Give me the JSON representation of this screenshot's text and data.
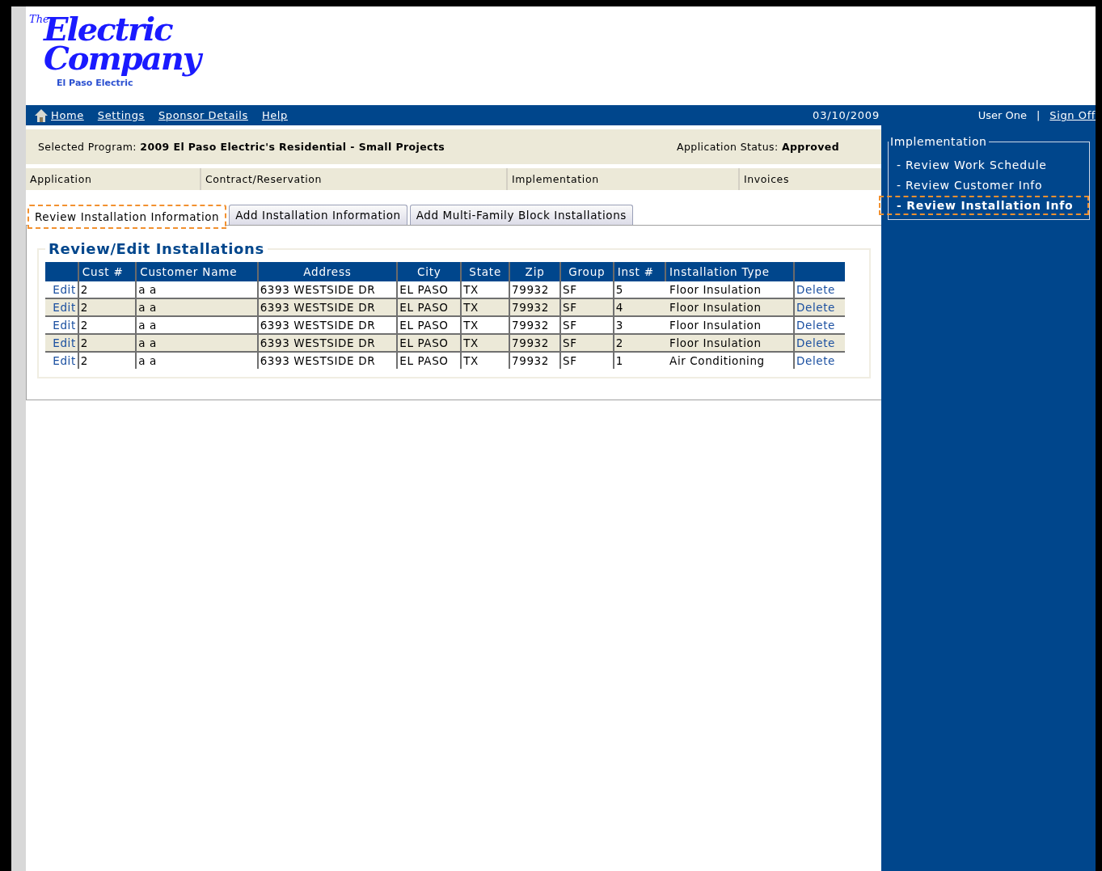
{
  "logo": {
    "small": "The",
    "line1": "Electric",
    "line2": "Company",
    "tagline": "El Paso Electric"
  },
  "nav": {
    "links": [
      "Home",
      "Settings",
      "Sponsor Details",
      "Help"
    ],
    "date": "03/10/2009",
    "user": "User One",
    "separator": "|",
    "sign_off": "Sign Off"
  },
  "program_bar": {
    "program_label": "Selected Program:",
    "program": "2009 El Paso Electric's Residential - Small Projects",
    "status_label": "Application Status:",
    "status": "Approved"
  },
  "phases": [
    "Application",
    "Contract/Reservation",
    "Implementation",
    "Invoices"
  ],
  "tabs": [
    {
      "label": "Review Installation Information",
      "selected": true
    },
    {
      "label": "Add Installation Information",
      "selected": false
    },
    {
      "label": "Add Multi-Family Block Installations",
      "selected": false
    }
  ],
  "section_title": "Review/Edit Installations",
  "table": {
    "columns": [
      "",
      "Cust #",
      "Customer Name",
      "Address",
      "City",
      "State",
      "Zip",
      "Group",
      "Inst #",
      "Installation Type",
      ""
    ],
    "rows": [
      {
        "cells": [
          "Edit",
          "2",
          "a a",
          "6393 WESTSIDE DR",
          "EL PASO",
          "TX",
          "79932",
          "SF",
          "5",
          "Floor Insulation",
          "Delete"
        ]
      },
      {
        "cells": [
          "Edit",
          "2",
          "a a",
          "6393 WESTSIDE DR",
          "EL PASO",
          "TX",
          "79932",
          "SF",
          "4",
          "Floor Insulation",
          "Delete"
        ]
      },
      {
        "cells": [
          "Edit",
          "2",
          "a a",
          "6393 WESTSIDE DR",
          "EL PASO",
          "TX",
          "79932",
          "SF",
          "3",
          "Floor Insulation",
          "Delete"
        ]
      },
      {
        "cells": [
          "Edit",
          "2",
          "a a",
          "6393 WESTSIDE DR",
          "EL PASO",
          "TX",
          "79932",
          "SF",
          "2",
          "Floor Insulation",
          "Delete"
        ]
      },
      {
        "cells": [
          "Edit",
          "2",
          "a a",
          "6393 WESTSIDE DR",
          "EL PASO",
          "TX",
          "79932",
          "SF",
          "1",
          "Air Conditioning",
          "Delete"
        ]
      }
    ]
  },
  "sidebar": {
    "title": "Implementation",
    "items": [
      {
        "label": "- Review Work Schedule",
        "selected": false
      },
      {
        "label": "- Review Customer Info",
        "selected": false
      },
      {
        "label": "- Review Installation Info",
        "selected": true
      }
    ]
  }
}
